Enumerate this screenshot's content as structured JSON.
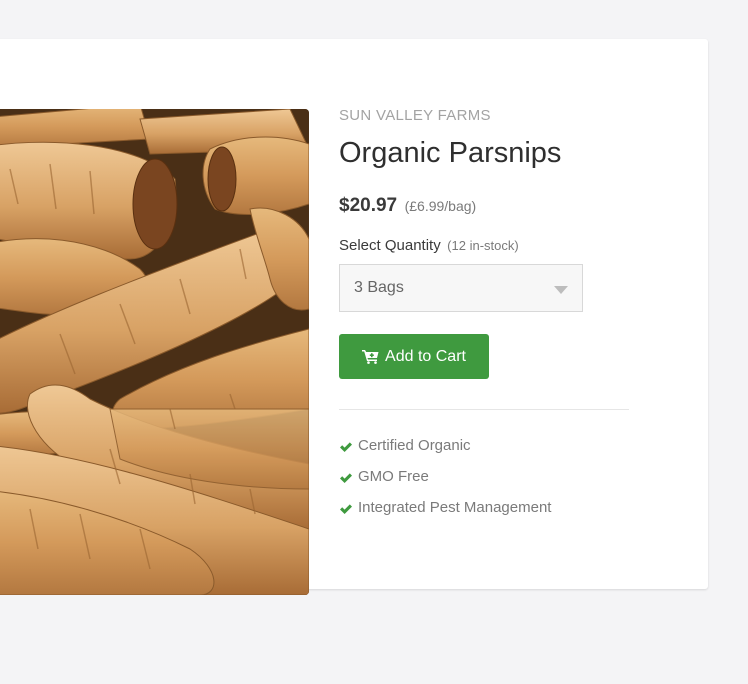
{
  "product": {
    "brand": "SUN VALLEY FARMS",
    "title": "Organic Parsnips",
    "price": "$20.97",
    "unit_price": "(£6.99/bag)",
    "image_icon": "parsnips-photo"
  },
  "quantity": {
    "label": "Select Quantity",
    "stock_note": "(12 in-stock)",
    "selected": "3 Bags",
    "arrow_icon": "caret-down-icon"
  },
  "cart": {
    "button_label": "Add to Cart",
    "icon": "cart-icon",
    "color": "#3f9a3f"
  },
  "features": [
    {
      "label": "Certified Organic",
      "icon": "check-icon"
    },
    {
      "label": "GMO Free",
      "icon": "check-icon"
    },
    {
      "label": "Integrated Pest Management",
      "icon": "check-icon"
    }
  ],
  "colors": {
    "accent": "#3f9a3f",
    "page_background": "#f4f4f6",
    "card_background": "#ffffff"
  }
}
